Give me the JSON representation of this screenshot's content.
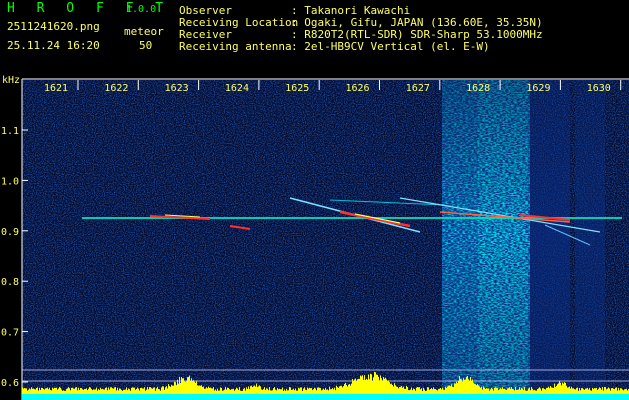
{
  "header": {
    "app_name": "H R O F F T",
    "version": "1.0.0",
    "filename": "2511241620.png",
    "mode": "meteor",
    "timestamp": "25.11.24 16:20",
    "count": "50",
    "info": [
      {
        "label": "Observer",
        "value": ": Takanori Kawachi"
      },
      {
        "label": "Receiving Location",
        "value": ": Ogaki, Gifu, JAPAN (136.60E, 35.35N)"
      },
      {
        "label": "Receiver",
        "value": ": R820T2(RTL-SDR) SDR-Sharp 53.1000MHz"
      },
      {
        "label": "Receiving antenna",
        "value": ": 2el-HB9CV Vertical (el. E-W)"
      }
    ]
  },
  "plot": {
    "y_unit": "kHz",
    "time_labels": [
      "1621",
      "1622",
      "1623",
      "1624",
      "1625",
      "1626",
      "1627",
      "1628",
      "1629",
      "1630"
    ],
    "freq_labels": [
      "1.1",
      "1.0",
      "0.9",
      "0.8",
      "0.7",
      "0.6"
    ],
    "colors": {
      "background": "#000000",
      "noise": "#0a2a8a",
      "carrier": "#00e0c0",
      "meteor": "#ff2020",
      "audio": "#ffff00",
      "base": "#00ffff"
    }
  }
}
